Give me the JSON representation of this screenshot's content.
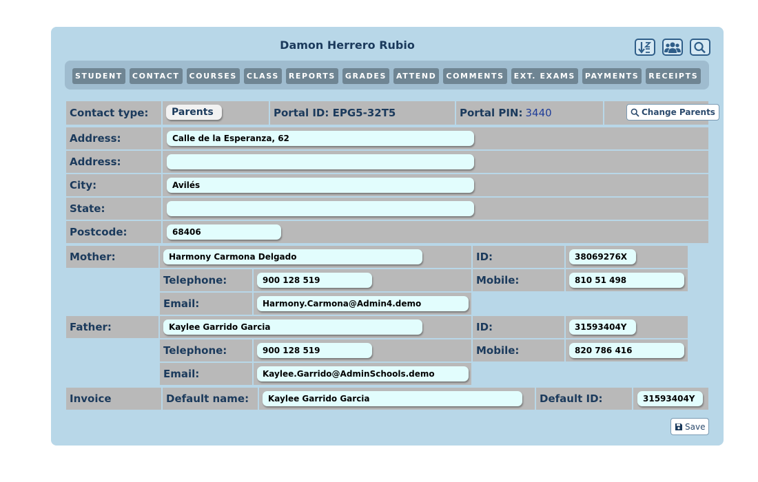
{
  "header": {
    "title": "Damon Herrero Rubio"
  },
  "toolbar_icons": [
    "sort-icon",
    "people-icon",
    "search-icon"
  ],
  "tabs": [
    "STUDENT",
    "CONTACT",
    "COURSES",
    "CLASS",
    "REPORTS",
    "GRADES",
    "ATTEND",
    "COMMENTS",
    "EXT. EXAMS",
    "PAYMENTS",
    "RECEIPTS"
  ],
  "contact": {
    "type_label": "Contact type:",
    "type_value": "Parents",
    "portal_id": "Portal ID: EPG5-32T5",
    "portal_pin_label": "Portal PIN:",
    "portal_pin_value": "3440",
    "change_button": "Change Parents"
  },
  "address": {
    "address_label": "Address:",
    "address1": "Calle de la Esperanza, 62",
    "address2_label": "Address:",
    "address2": "",
    "city_label": "City:",
    "city": "Avilés",
    "state_label": "State:",
    "state": "",
    "postcode_label": "Postcode:",
    "postcode": "68406"
  },
  "mother": {
    "label": "Mother:",
    "name": "Harmony Carmona Delgado",
    "id_label": "ID:",
    "id": "38069276X",
    "telephone_label": "Telephone:",
    "telephone": "900 128 519",
    "mobile_label": "Mobile:",
    "mobile": "810 51 498",
    "email_label": "Email:",
    "email": "Harmony.Carmona@Admin4.demo"
  },
  "father": {
    "label": "Father:",
    "name": "Kaylee Garrido Garcia",
    "id_label": "ID:",
    "id": "31593404Y",
    "telephone_label": "Telephone:",
    "telephone": "900 128 519",
    "mobile_label": "Mobile:",
    "mobile": "820 786 416",
    "email_label": "Email:",
    "email": "Kaylee.Garrido@AdminSchools.demo"
  },
  "invoice": {
    "label": "Invoice",
    "default_name_label": "Default name:",
    "default_name": "Kaylee Garrido Garcia",
    "default_id_label": "Default ID:",
    "default_id": "31593404Y"
  },
  "footer": {
    "save_label": "Save"
  }
}
